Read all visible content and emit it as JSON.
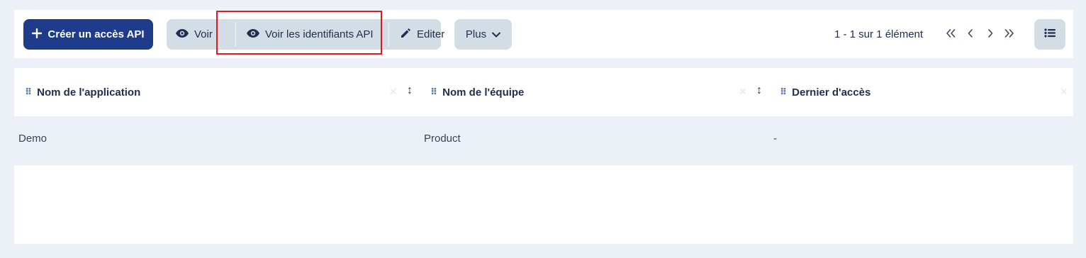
{
  "toolbar": {
    "create_label": "Créer un accès API",
    "view_label": "Voir",
    "view_credentials_label": "Voir les identifiants API",
    "edit_label": "Editer",
    "more_label": "Plus",
    "pagination_text": "1 - 1 sur 1 élément"
  },
  "table": {
    "columns": [
      "Nom de l'application",
      "Nom de l'équipe",
      "Dernier d'accès"
    ],
    "rows": [
      [
        "Demo",
        "Product",
        "-"
      ]
    ]
  },
  "colors": {
    "primary": "#1f3b8c",
    "secondary_button": "#d3dde6",
    "highlight": "#e01b1b",
    "background": "#ecf0f7"
  }
}
